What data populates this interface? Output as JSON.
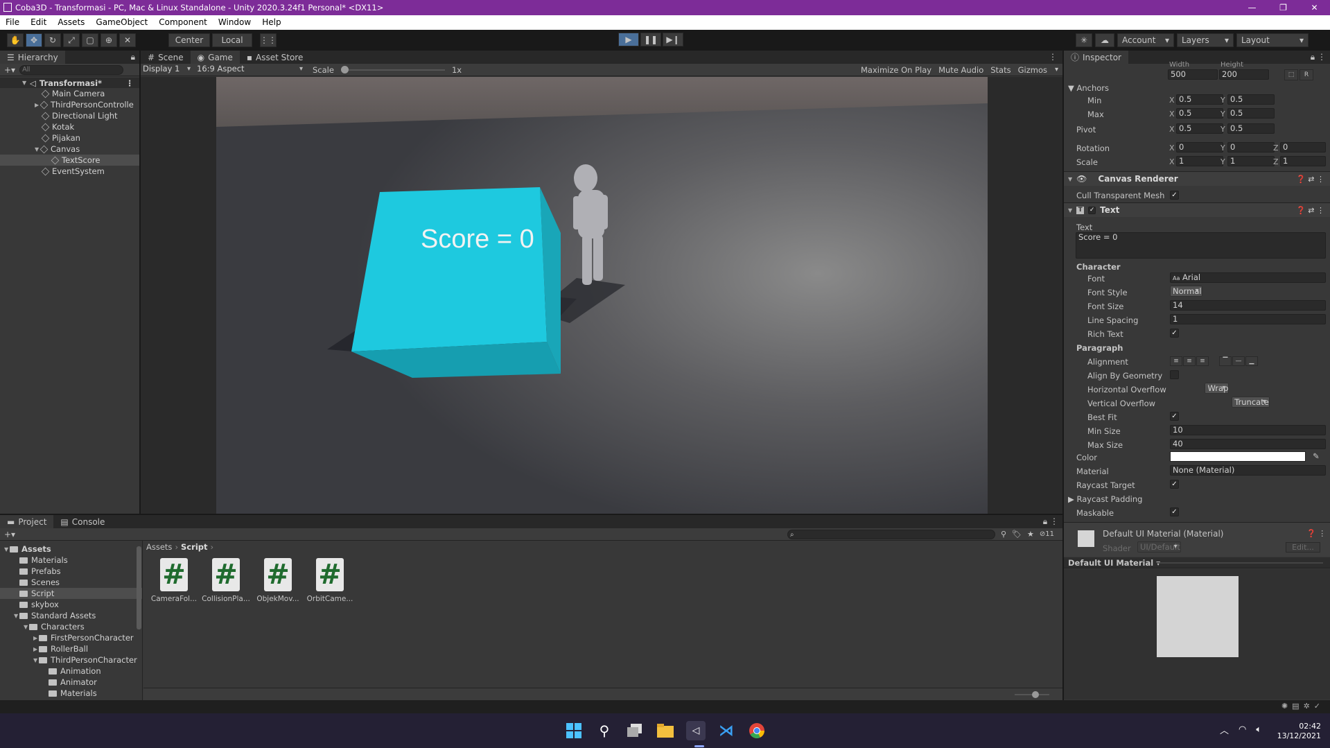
{
  "titlebar": {
    "title": "Coba3D - Transformasi - PC, Mac & Linux Standalone - Unity 2020.3.24f1 Personal* <DX11>",
    "minimize": "—",
    "maximize": "❐",
    "close": "✕"
  },
  "menu": [
    "File",
    "Edit",
    "Assets",
    "GameObject",
    "Component",
    "Window",
    "Help"
  ],
  "toolbar": {
    "center": "Center",
    "local": "Local",
    "account": "Account",
    "layers": "Layers",
    "layout": "Layout"
  },
  "hierarchy": {
    "tab": "Hierarchy",
    "search_placeholder": "All",
    "scene": "Transformasi*",
    "items": [
      "Main Camera",
      "ThirdPersonControlle",
      "Directional Light",
      "Kotak",
      "Pijakan",
      "Canvas",
      "TextScore",
      "EventSystem"
    ]
  },
  "game": {
    "tabs": [
      "Scene",
      "Game",
      "Asset Store"
    ],
    "display": "Display 1",
    "aspect": "16:9 Aspect",
    "scale_label": "Scale",
    "scale_value": "1x",
    "maximize": "Maximize On Play",
    "mute": "Mute Audio",
    "stats": "Stats",
    "gizmos": "Gizmos",
    "score_text": "Score = 0"
  },
  "inspector": {
    "tab": "Inspector",
    "width_label": "Width",
    "height_label": "Height",
    "width": "500",
    "height": "200",
    "anchors": "Anchors",
    "min": "Min",
    "max": "Max",
    "pivot": "Pivot",
    "rotation": "Rotation",
    "scale": "Scale",
    "min_x": "0.5",
    "min_y": "0.5",
    "max_x": "0.5",
    "max_y": "0.5",
    "pivot_x": "0.5",
    "pivot_y": "0.5",
    "rot_x": "0",
    "rot_y": "0",
    "rot_z": "0",
    "scale_x": "1",
    "scale_y": "1",
    "scale_z": "1",
    "canvas_renderer": "Canvas Renderer",
    "cull": "Cull Transparent Mesh",
    "text_component": "Text",
    "text_label": "Text",
    "text_value": "Score = 0",
    "character": "Character",
    "font": "Font",
    "font_value": "Arial",
    "font_style": "Font Style",
    "font_style_value": "Normal",
    "font_size": "Font Size",
    "font_size_value": "14",
    "line_spacing": "Line Spacing",
    "line_spacing_value": "1",
    "rich_text": "Rich Text",
    "paragraph": "Paragraph",
    "alignment": "Alignment",
    "align_geom": "Align By Geometry",
    "h_overflow": "Horizontal Overflow",
    "h_overflow_value": "Wrap",
    "v_overflow": "Vertical Overflow",
    "v_overflow_value": "Truncate",
    "best_fit": "Best Fit",
    "min_size": "Min Size",
    "min_size_value": "10",
    "max_size": "Max Size",
    "max_size_value": "40",
    "color": "Color",
    "material": "Material",
    "material_value": "None (Material)",
    "raycast_target": "Raycast Target",
    "raycast_padding": "Raycast Padding",
    "maskable": "Maskable",
    "default_material": "Default UI Material (Material)",
    "shader_label": "Shader",
    "shader_value": "UI/Default",
    "edit": "Edit...",
    "preview_label": "Default UI Material"
  },
  "project": {
    "tabs": [
      "Project",
      "Console"
    ],
    "hidden_count": "11",
    "breadcrumb": [
      "Assets",
      "Script"
    ],
    "tree": [
      {
        "label": "Assets",
        "indent": 0,
        "bold": true
      },
      {
        "label": "Materials",
        "indent": 1
      },
      {
        "label": "Prefabs",
        "indent": 1
      },
      {
        "label": "Scenes",
        "indent": 1
      },
      {
        "label": "Script",
        "indent": 1,
        "selected": true
      },
      {
        "label": "skybox",
        "indent": 1
      },
      {
        "label": "Standard Assets",
        "indent": 1
      },
      {
        "label": "Characters",
        "indent": 2
      },
      {
        "label": "FirstPersonCharacter",
        "indent": 3
      },
      {
        "label": "RollerBall",
        "indent": 3
      },
      {
        "label": "ThirdPersonCharacter",
        "indent": 3
      },
      {
        "label": "Animation",
        "indent": 4
      },
      {
        "label": "Animator",
        "indent": 4
      },
      {
        "label": "Materials",
        "indent": 4
      }
    ],
    "assets": [
      "CameraFol...",
      "CollisionPla...",
      "ObjekMov...",
      "OrbitCame..."
    ],
    "asset_glyph": "#"
  },
  "taskbar": {
    "time": "02:42",
    "date": "13/12/2021"
  },
  "colors": {
    "accent": "#7d2c98",
    "cube": "#1ec9df",
    "selection": "#4a6f99"
  }
}
